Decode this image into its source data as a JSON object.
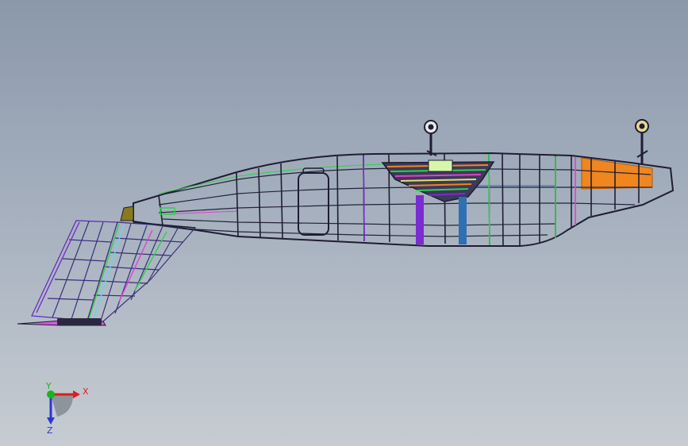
{
  "viewport": {
    "background_top": "#8b98ab",
    "background_bottom": "#c6ccd2"
  },
  "model": {
    "description_icon": "wireframe-aircraft-fuselage",
    "colors": {
      "frame": "#1f1d33",
      "accent_orange": "#f0861f",
      "accent_purple": "#7a2bd1",
      "accent_blue": "#2f6fb3",
      "accent_green": "#2fd24a",
      "accent_magenta": "#e23fd4",
      "accent_olive": "#8a7a1e"
    }
  },
  "triad": {
    "x_label": "X",
    "y_label": "Y",
    "z_label": "Z",
    "x_color": "#e21b1b",
    "y_color": "#18b51b",
    "z_color": "#2a36d6"
  }
}
